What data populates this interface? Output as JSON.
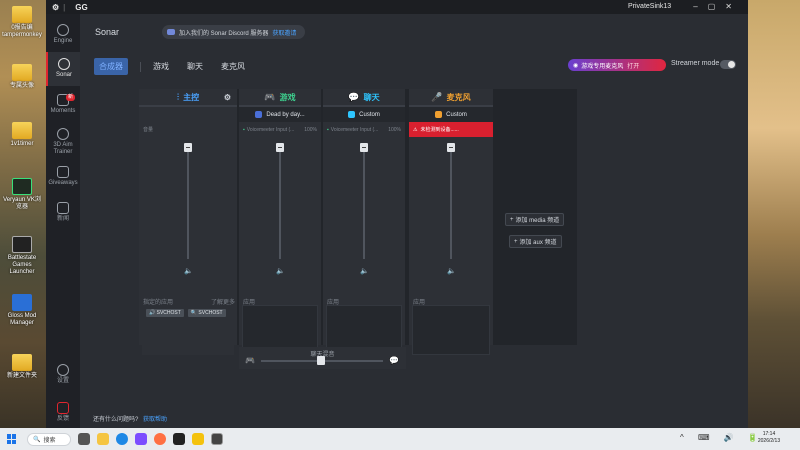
{
  "desktop": {
    "icons": [
      "0报告编",
      "tampermonkey",
      "专属头像",
      "1v1timer",
      "Veryaun VK浏览器",
      "Battlestate Games Launcher",
      "Gloss Mod Manager",
      "新建文件夹"
    ]
  },
  "window": {
    "app_name": "GG",
    "user": "PrivateSink13"
  },
  "sidebar": {
    "items": [
      {
        "label": "Engine"
      },
      {
        "label": "Sonar"
      },
      {
        "label": "Moments",
        "badge": "新"
      },
      {
        "label": "3D Aim Trainer"
      },
      {
        "label": "Giveaways"
      },
      {
        "label": "新闻"
      },
      {
        "label": "设置"
      },
      {
        "label": "反馈"
      }
    ]
  },
  "header": {
    "title": "Sonar",
    "discord_text": "加入我们的 Sonar Discord 服务器",
    "discord_link": "获取邀请",
    "tabs": [
      "合成器",
      "游戏",
      "聊天",
      "麦克风"
    ],
    "mic_banner_text": "游戏专用麦克风",
    "mic_banner_link": "打开",
    "streamer_mode": "Streamer mode"
  },
  "mixer": {
    "channels": [
      {
        "name": "主控",
        "color": "#4aa3ff",
        "device": "",
        "sub_left": "音量",
        "sub_right": "",
        "apps_label": "指定的应用",
        "apps_right": "了解更多",
        "apps": [
          "SVCHOST",
          "SVCHOST"
        ]
      },
      {
        "name": "游戏",
        "color": "#3ecf8e",
        "device": "Dead by day...",
        "sub_left": "Voicemeeter Input (...",
        "sub_right": "100%",
        "apps_label": "应用",
        "apps_right": "",
        "apps": []
      },
      {
        "name": "聊天",
        "color": "#2ec6ff",
        "device": "Custom",
        "sub_left": "Voicemeeter Input (...",
        "sub_right": "100%",
        "apps_label": "应用",
        "apps_right": "",
        "apps": []
      },
      {
        "name": "麦克风",
        "color": "#f0a030",
        "device": "Custom",
        "sub_left": "未检测到设备......",
        "sub_right": "",
        "apps_label": "应用",
        "apps_right": "",
        "apps": []
      }
    ],
    "add_media": "添加 media 频道",
    "add_aux": "添加 aux 频道",
    "chatmix_label": "聊天混音"
  },
  "footer": {
    "help_text": "还有什么问题吗?",
    "help_link": "获取帮助"
  },
  "taskbar": {
    "search": "搜索",
    "time": "17:14",
    "date": "2026/2/13"
  },
  "colors": {
    "accent_red": "#e0262f",
    "accent_blue": "#4aa3ff"
  }
}
